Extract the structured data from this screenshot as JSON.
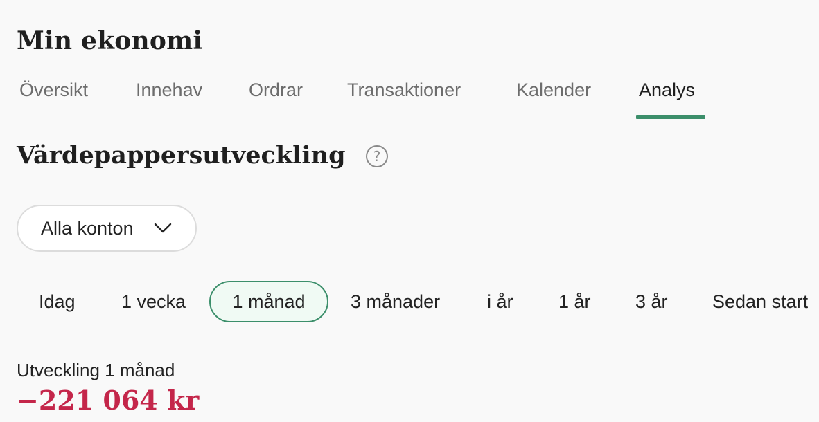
{
  "header": {
    "title": "Min ekonomi"
  },
  "tabs": [
    {
      "label": "Översikt"
    },
    {
      "label": "Innehav"
    },
    {
      "label": "Ordrar"
    },
    {
      "label": "Transaktioner"
    },
    {
      "label": "Kalender"
    },
    {
      "label": "Analys",
      "active": true
    }
  ],
  "section": {
    "title": "Värdepappersutveckling",
    "help_icon": "question-circle-icon"
  },
  "account_select": {
    "value": "Alla konton",
    "icon": "chevron-down-icon"
  },
  "periods": [
    {
      "label": "Idag"
    },
    {
      "label": "1 vecka"
    },
    {
      "label": "1 månad",
      "active": true
    },
    {
      "label": "3 månader"
    },
    {
      "label": "i år"
    },
    {
      "label": "1 år"
    },
    {
      "label": "3 år"
    },
    {
      "label": "Sedan start"
    }
  ],
  "development": {
    "label": "Utveckling 1 månad",
    "value": "−221 064 kr"
  },
  "colors": {
    "accent": "#3c8f6b",
    "negative": "#c4264a",
    "background": "#f9f9f9"
  }
}
